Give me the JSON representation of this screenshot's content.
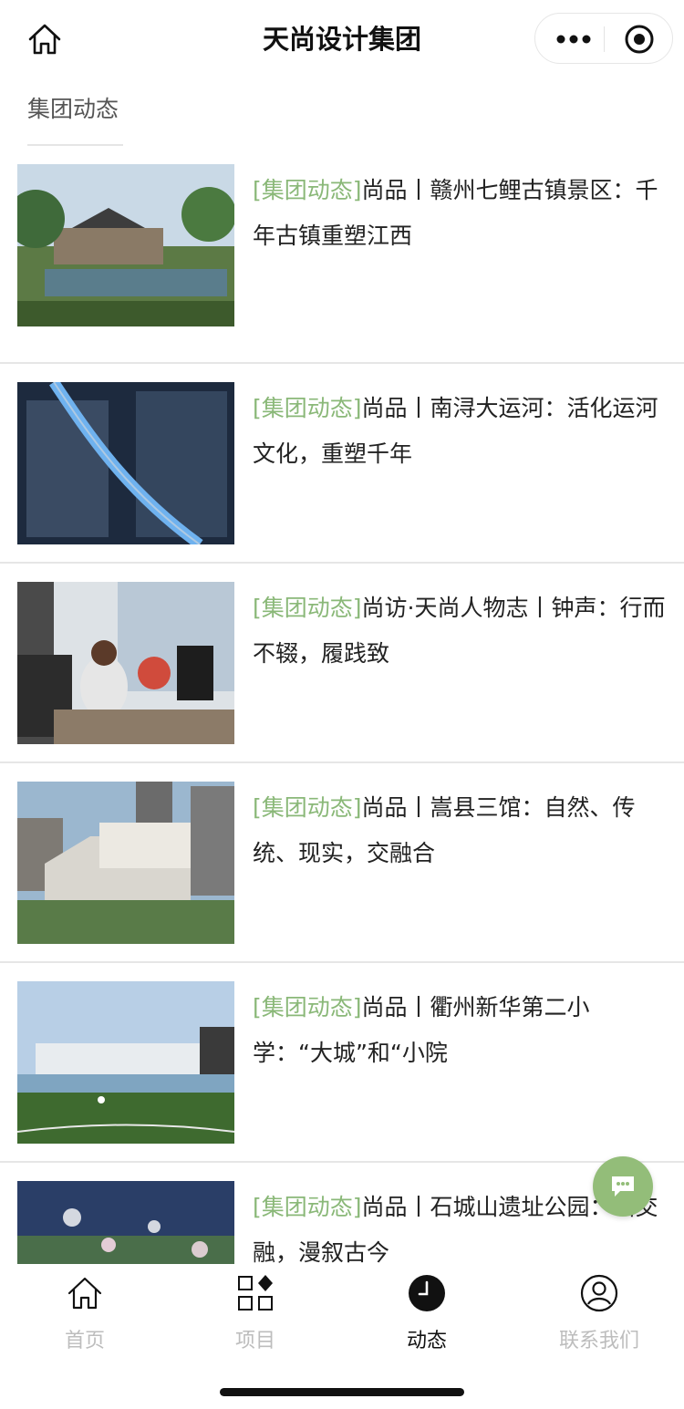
{
  "header": {
    "title": "天尚设计集团",
    "home_icon": "home-icon",
    "more_icon": "more-dots-icon",
    "target_icon": "target-icon"
  },
  "section": {
    "title": "集团动态"
  },
  "colors": {
    "tag": "#8ab878",
    "fab": "#93bd79"
  },
  "articles": [
    {
      "tag": "[集团动态]",
      "title": "尚品丨赣州七鲤古镇景区：千年古镇重塑江西"
    },
    {
      "tag": "[集团动态]",
      "title": "尚品丨南浔大运河：活化运河文化，重塑千年"
    },
    {
      "tag": "[集团动态]",
      "title": "尚访·天尚人物志丨钟声：行而不辍，履践致"
    },
    {
      "tag": "[集团动态]",
      "title": "尚品丨嵩县三馆：自然、传统、现实，交融合"
    },
    {
      "tag": "[集团动态]",
      "title": "尚品丨衢州新华第二小学：“大城”和“小院"
    },
    {
      "tag": "[集团动态]",
      "title": "尚品丨石城山遗址公园：山交融，漫叙古今"
    }
  ],
  "fab": {
    "icon": "chat-icon"
  },
  "tabbar": {
    "tabs": [
      {
        "label": "首页",
        "icon": "home-icon",
        "active": false
      },
      {
        "label": "项目",
        "icon": "grid-icon",
        "active": false
      },
      {
        "label": "动态",
        "icon": "clock-icon",
        "active": true
      },
      {
        "label": "联系我们",
        "icon": "user-circle-icon",
        "active": false
      }
    ]
  }
}
